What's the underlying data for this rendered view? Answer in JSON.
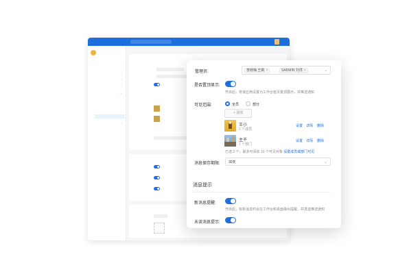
{
  "app": {
    "brand": "",
    "brand_sub": "",
    "search_placeholder": "",
    "user_name": "",
    "user_role": "",
    "breadcrumb": "",
    "sidebar": {
      "items": [
        "",
        "",
        "",
        "",
        ""
      ],
      "subitems": [
        "",
        "",
        "",
        ""
      ],
      "active_subitem_index": 3,
      "last_item": ""
    },
    "cards": {
      "basic_title": "",
      "msg_title": "",
      "extra_title": ""
    }
  },
  "modal": {
    "admins_label": "管理员:",
    "admins_tags": [
      "李晓梅 王莉",
      "SADMIN 刘洋"
    ],
    "pin_label": "是否置顶显示:",
    "pin_hint": "开启后，将该应用设置为工作台首页置顶展示，并推送通知",
    "visibility_label": "可见范围:",
    "visibility_options": [
      "全员",
      "部分"
    ],
    "visibility_selected": "全员",
    "add_button": "+ 添加",
    "members": [
      {
        "name": "王小",
        "meta": "2 个成员",
        "actions": [
          "设置",
          "详情",
          "删除"
        ],
        "thumb": "yellow"
      },
      {
        "name": "主干",
        "meta": "1 个部门",
        "actions": [
          "设置",
          "详情",
          "删除"
        ],
        "thumb": "street"
      }
    ],
    "members_hint": "已选 2 个，最多可添加 10 个可见对象",
    "members_hint_link": "设置成员或部门可见",
    "expire_label": "消息保存期限:",
    "expire_value": "30天",
    "notify_section": "消息提示",
    "notify_items": [
      {
        "label": "新消息提醒:",
        "hint": "开启后，有新消息时会在工作台和桌面弹出提醒，并发送推送通知"
      },
      {
        "label": "未读消息提示:",
        "hint": ""
      }
    ]
  }
}
